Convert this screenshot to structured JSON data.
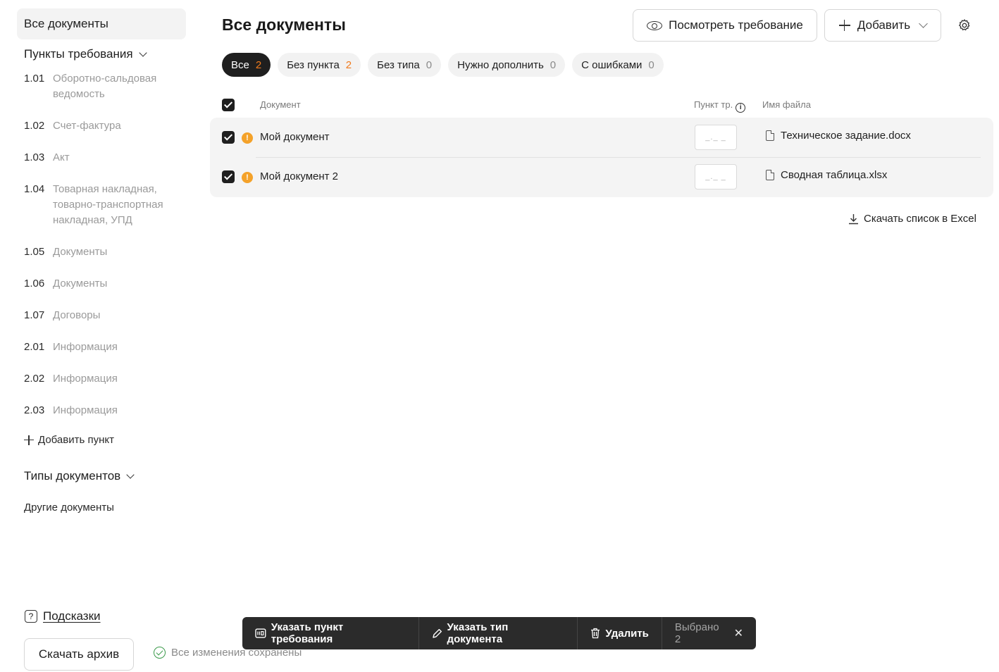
{
  "sidebar": {
    "all_docs": "Все документы",
    "requirements_section": "Пункты требования",
    "items": [
      {
        "num": "1.01",
        "label": "Оборотно-сальдовая ведомость"
      },
      {
        "num": "1.02",
        "label": "Счет-фактура"
      },
      {
        "num": "1.03",
        "label": "Акт"
      },
      {
        "num": "1.04",
        "label": "Товарная накладная, товарно-транспортная накладная, УПД"
      },
      {
        "num": "1.05",
        "label": "Документы"
      },
      {
        "num": "1.06",
        "label": "Документы"
      },
      {
        "num": "1.07",
        "label": "Договоры"
      },
      {
        "num": "2.01",
        "label": "Информация"
      },
      {
        "num": "2.02",
        "label": "Информация"
      },
      {
        "num": "2.03",
        "label": "Информация"
      }
    ],
    "add_item": "Добавить пункт",
    "doc_types_section": "Типы документов",
    "other_docs": "Другие документы"
  },
  "footer": {
    "hints": "Подсказки",
    "download_archive": "Скачать архив",
    "saved_status": "Все изменения сохранены"
  },
  "header": {
    "title": "Все документы",
    "view_requirement": "Посмотреть требование",
    "add": "Добавить"
  },
  "filters": [
    {
      "label": "Все",
      "count": "2"
    },
    {
      "label": "Без пункта",
      "count": "2"
    },
    {
      "label": "Без типа",
      "count": "0"
    },
    {
      "label": "Нужно дополнить",
      "count": "0"
    },
    {
      "label": "С ошибками",
      "count": "0"
    }
  ],
  "table": {
    "columns": {
      "document": "Документ",
      "point": "Пункт тр.",
      "filename": "Имя файла"
    },
    "rows": [
      {
        "name": "Мой документ",
        "point_placeholder": "_._ _",
        "file": "Техническое задание.docx"
      },
      {
        "name": "Мой документ 2",
        "point_placeholder": "_._ _",
        "file": "Сводная таблица.xlsx"
      }
    ],
    "excel_link": "Скачать список в Excel"
  },
  "actionbar": {
    "set_point": "Указать пункт требования",
    "set_type": "Указать тип документа",
    "delete": "Удалить",
    "selected": "Выбрано 2"
  },
  "colors": {
    "accent": "#f07a1c",
    "warning": "#f4a22a",
    "dark": "#1f1f1f",
    "success": "#3a9a4a"
  }
}
